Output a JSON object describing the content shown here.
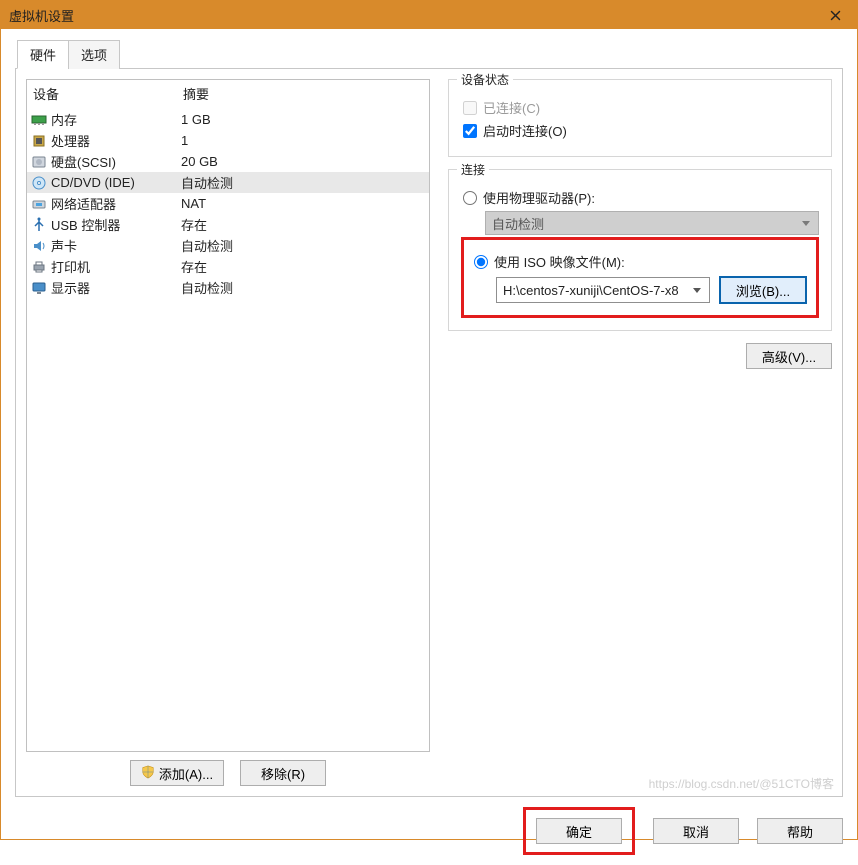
{
  "window": {
    "title": "虚拟机设置"
  },
  "tabs": {
    "hardware": "硬件",
    "options": "选项"
  },
  "device_list": {
    "col_device": "设备",
    "col_summary": "摘要",
    "rows": [
      {
        "icon": "memory",
        "label": "内存",
        "summary": "1 GB"
      },
      {
        "icon": "cpu",
        "label": "处理器",
        "summary": "1"
      },
      {
        "icon": "disk",
        "label": "硬盘(SCSI)",
        "summary": "20 GB"
      },
      {
        "icon": "cd",
        "label": "CD/DVD (IDE)",
        "summary": "自动检测",
        "selected": true
      },
      {
        "icon": "nic",
        "label": "网络适配器",
        "summary": "NAT"
      },
      {
        "icon": "usb",
        "label": "USB 控制器",
        "summary": "存在"
      },
      {
        "icon": "sound",
        "label": "声卡",
        "summary": "自动检测"
      },
      {
        "icon": "printer",
        "label": "打印机",
        "summary": "存在"
      },
      {
        "icon": "display",
        "label": "显示器",
        "summary": "自动检测"
      }
    ]
  },
  "buttons": {
    "add": "添加(A)...",
    "remove": "移除(R)",
    "browse": "浏览(B)...",
    "advanced": "高级(V)...",
    "ok": "确定",
    "cancel": "取消",
    "help": "帮助"
  },
  "groups": {
    "status_title": "设备状态",
    "connected": "已连接(C)",
    "connect_at_power_on": "启动时连接(O)",
    "connection_title": "连接",
    "use_physical": "使用物理驱动器(P):",
    "physical_value": "自动检测",
    "use_iso": "使用 ISO 映像文件(M):",
    "iso_path": "H:\\centos7-xuniji\\CentOS-7-x8"
  },
  "watermark": "https://blog.csdn.net/@51CTO博客"
}
